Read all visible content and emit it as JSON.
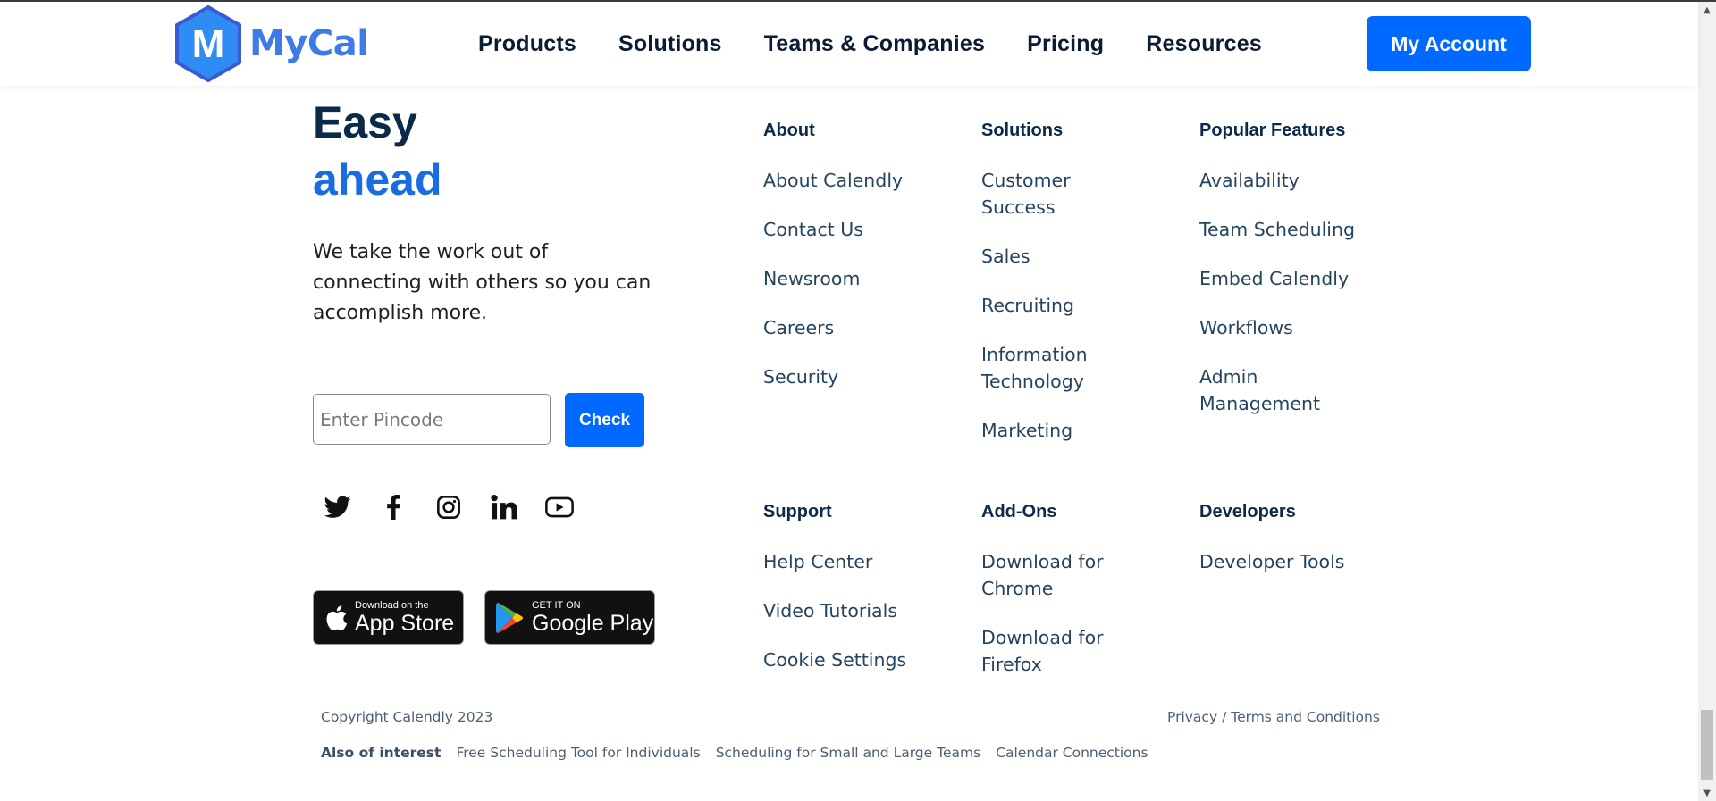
{
  "brand": {
    "name": "MyCal",
    "logo_letter": "M",
    "logo_color": "#2f8cf5",
    "accent": "#0069ff"
  },
  "nav": {
    "items": [
      "Products",
      "Solutions",
      "Teams & Companies",
      "Pricing",
      "Resources"
    ],
    "account_label": "My Account"
  },
  "hero": {
    "line1": "Easy",
    "line2": "ahead",
    "description": "We take the work out of connecting with others so you can accomplish more."
  },
  "pincode": {
    "placeholder": "Enter Pincode",
    "value": "",
    "button_label": "Check"
  },
  "socials": [
    "twitter-icon",
    "facebook-icon",
    "instagram-icon",
    "linkedin-icon",
    "youtube-icon"
  ],
  "stores": {
    "apple": {
      "small": "Download on the",
      "big": "App Store"
    },
    "google": {
      "small": "GET IT ON",
      "big": "Google Play"
    }
  },
  "columns": [
    {
      "heading": "About",
      "links": [
        "About Calendly",
        "Contact Us",
        "Newsroom",
        "Careers",
        "Security"
      ]
    },
    {
      "heading": "Solutions",
      "links": [
        "Customer Success",
        "Sales",
        "Recruiting",
        "Information Technology",
        "Marketing"
      ]
    },
    {
      "heading": "Popular Features",
      "links": [
        "Availability",
        "Team Scheduling",
        "Embed Calendly",
        "Workflows",
        "Admin Management"
      ]
    },
    {
      "heading": "Support",
      "links": [
        "Help Center",
        "Video Tutorials",
        "Cookie Settings"
      ]
    },
    {
      "heading": "Add-Ons",
      "links": [
        "Download for Chrome",
        "Download for Firefox"
      ]
    },
    {
      "heading": "Developers",
      "links": [
        "Developer Tools"
      ]
    }
  ],
  "footer": {
    "copyright": "Copyright Calendly 2023",
    "privacy": "Privacy",
    "separator": "/",
    "terms": "Terms and Conditions",
    "interest_label": "Also of interest",
    "interest_links": [
      "Free Scheduling Tool for Individuals",
      "Scheduling for Small and Large Teams",
      "Calendar Connections"
    ]
  }
}
